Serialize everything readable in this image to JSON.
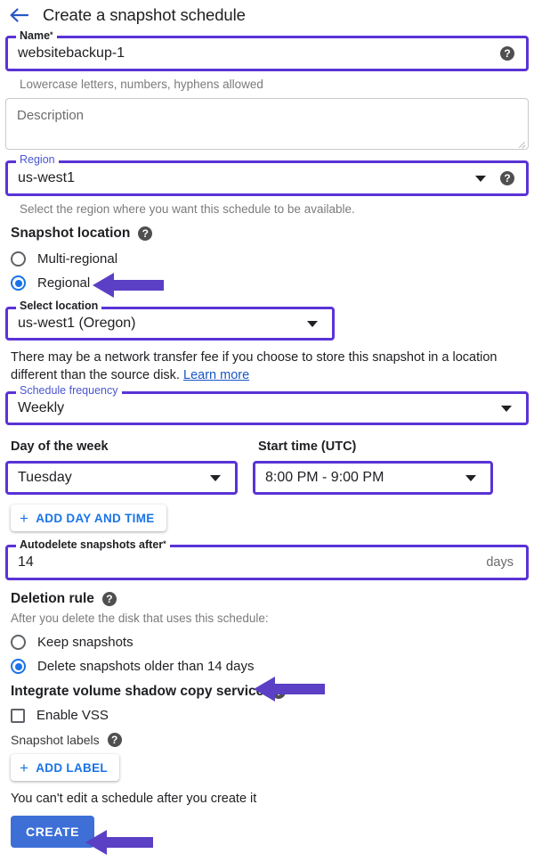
{
  "header": {
    "back_icon": "arrow-left-icon",
    "title": "Create a snapshot schedule"
  },
  "name_field": {
    "legend": "Name",
    "required_mark": "*",
    "value": "websitebackup-1",
    "help_icon": "help-circle-icon",
    "hint": "Lowercase letters, numbers, hyphens allowed"
  },
  "description_field": {
    "placeholder": "Description",
    "value": ""
  },
  "region_field": {
    "legend": "Region",
    "value": "us-west1",
    "help_icon": "help-circle-icon",
    "hint": "Select the region where you want this schedule to be available.",
    "options": [
      "us-west1"
    ]
  },
  "snapshot_location": {
    "heading": "Snapshot location",
    "help_icon": "help-circle-icon",
    "options": [
      {
        "label": "Multi-regional",
        "selected": false
      },
      {
        "label": "Regional",
        "selected": true
      }
    ],
    "select_location": {
      "legend": "Select location",
      "value": "us-west1 (Oregon)",
      "options": [
        "us-west1 (Oregon)"
      ]
    },
    "note_text": "There may be a network transfer fee if you choose to store this snapshot in a location different than the source disk.",
    "note_link": "Learn more"
  },
  "schedule_frequency": {
    "legend": "Schedule frequency",
    "value": "Weekly",
    "options": [
      "Weekly"
    ]
  },
  "day_of_week": {
    "label": "Day of the week",
    "value": "Tuesday",
    "options": [
      "Tuesday"
    ]
  },
  "start_time": {
    "label": "Start time (UTC)",
    "value": "8:00 PM - 9:00 PM",
    "options": [
      "8:00 PM - 9:00 PM"
    ]
  },
  "add_day_and_time": {
    "label": "ADD DAY AND TIME",
    "plus_icon": "plus-icon"
  },
  "autodelete": {
    "legend": "Autodelete snapshots after",
    "required_mark": "*",
    "value": "14",
    "suffix": "days"
  },
  "deletion_rule": {
    "heading": "Deletion rule",
    "help_icon": "help-circle-icon",
    "subtext": "After you delete the disk that uses this schedule:",
    "options": [
      {
        "label": "Keep snapshots",
        "selected": false
      },
      {
        "label": "Delete snapshots older than 14 days",
        "selected": true
      }
    ]
  },
  "vss": {
    "heading": "Integrate volume shadow copy service",
    "help_icon": "help-circle-icon",
    "checkbox_label": "Enable VSS",
    "checked": false
  },
  "snapshot_labels": {
    "heading": "Snapshot labels",
    "help_icon": "help-circle-icon",
    "add_label_button": "ADD LABEL",
    "plus_icon": "plus-icon"
  },
  "footer": {
    "warning": "You can't edit a schedule after you create it",
    "create_button": "CREATE"
  },
  "colors": {
    "highlight_border": "#5a33d6",
    "annotation_arrow": "#5b3fc4",
    "accent_blue": "#1a73e8",
    "create_button": "#3d6fd6",
    "link": "#1a56c4"
  },
  "annotations": [
    {
      "name": "arrow-pointing-regional-radio",
      "target": "Regional"
    },
    {
      "name": "arrow-pointing-delete-snapshots-radio",
      "target": "Delete snapshots older than 14 days"
    },
    {
      "name": "arrow-pointing-create-button",
      "target": "CREATE"
    }
  ]
}
